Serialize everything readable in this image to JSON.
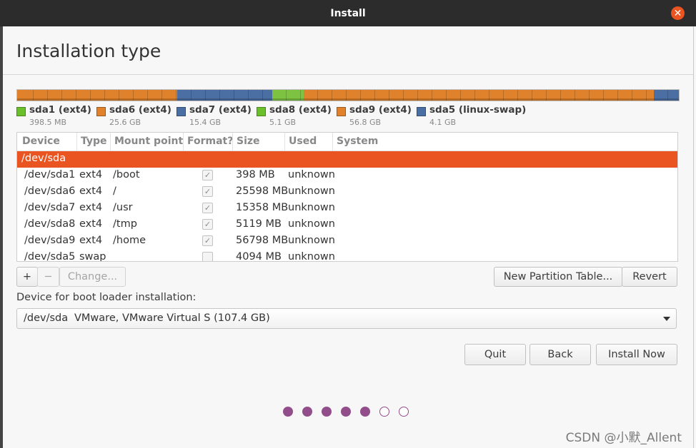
{
  "window": {
    "title": "Install",
    "close_icon": "close-icon"
  },
  "page": {
    "title": "Installation type"
  },
  "disk_bar": {
    "segments": [
      {
        "name": "sda1",
        "fraction": 0.0037,
        "color": "#e0822b"
      },
      {
        "name": "sda6",
        "fraction": 0.2385,
        "color": "#e0822b"
      },
      {
        "name": "sda7",
        "fraction": 0.1431,
        "color": "#4c6fa3"
      },
      {
        "name": "sda8",
        "fraction": 0.0476,
        "color": "#7dc241"
      },
      {
        "name": "sda9",
        "fraction": 0.529,
        "color": "#e0822b"
      },
      {
        "name": "sda5",
        "fraction": 0.0381,
        "color": "#4c6fa3"
      }
    ]
  },
  "legend": [
    {
      "name": "sda1 (ext4)",
      "size": "398.5 MB",
      "color": "#6abf2a"
    },
    {
      "name": "sda6 (ext4)",
      "size": "25.6 GB",
      "color": "#e0822b"
    },
    {
      "name": "sda7 (ext4)",
      "size": "15.4 GB",
      "color": "#4c6fa3"
    },
    {
      "name": "sda8 (ext4)",
      "size": "5.1 GB",
      "color": "#6abf2a"
    },
    {
      "name": "sda9 (ext4)",
      "size": "56.8 GB",
      "color": "#e0822b"
    },
    {
      "name": "sda5 (linux-swap)",
      "size": "4.1 GB",
      "color": "#4c6fa3"
    }
  ],
  "table": {
    "columns": [
      "Device",
      "Type",
      "Mount point",
      "Format?",
      "Size",
      "Used",
      "System"
    ],
    "header_row": {
      "device": "/dev/sda"
    },
    "rows": [
      {
        "device": "/dev/sda1",
        "type": "ext4",
        "mount": "/boot",
        "format": true,
        "size": "398 MB",
        "used": "unknown"
      },
      {
        "device": "/dev/sda6",
        "type": "ext4",
        "mount": "/",
        "format": true,
        "size": "25598 MB",
        "used": "unknown"
      },
      {
        "device": "/dev/sda7",
        "type": "ext4",
        "mount": "/usr",
        "format": true,
        "size": "15358 MB",
        "used": "unknown"
      },
      {
        "device": "/dev/sda8",
        "type": "ext4",
        "mount": "/tmp",
        "format": true,
        "size": "5119 MB",
        "used": "unknown"
      },
      {
        "device": "/dev/sda9",
        "type": "ext4",
        "mount": "/home",
        "format": true,
        "size": "56798 MB",
        "used": "unknown"
      },
      {
        "device": "/dev/sda5",
        "type": "swap",
        "mount": "",
        "format": false,
        "size": "4094 MB",
        "used": "unknown"
      }
    ]
  },
  "table_actions": {
    "add_label": "+",
    "remove_label": "−",
    "change_label": "Change...",
    "new_partition_table_label": "New Partition Table...",
    "revert_label": "Revert"
  },
  "boot_loader": {
    "label": "Device for boot loader installation:",
    "selected_device": "/dev/sda",
    "selected_description": "VMware, VMware Virtual S (107.4 GB)"
  },
  "footer": {
    "quit_label": "Quit",
    "back_label": "Back",
    "install_label": "Install Now"
  },
  "progress": {
    "total_steps": 7,
    "completed_steps": 5
  },
  "watermark": "CSDN @小默_Allent",
  "colors": {
    "accent": "#e95420",
    "progress": "#924d8b",
    "titlebar": "#2c2c2c"
  }
}
